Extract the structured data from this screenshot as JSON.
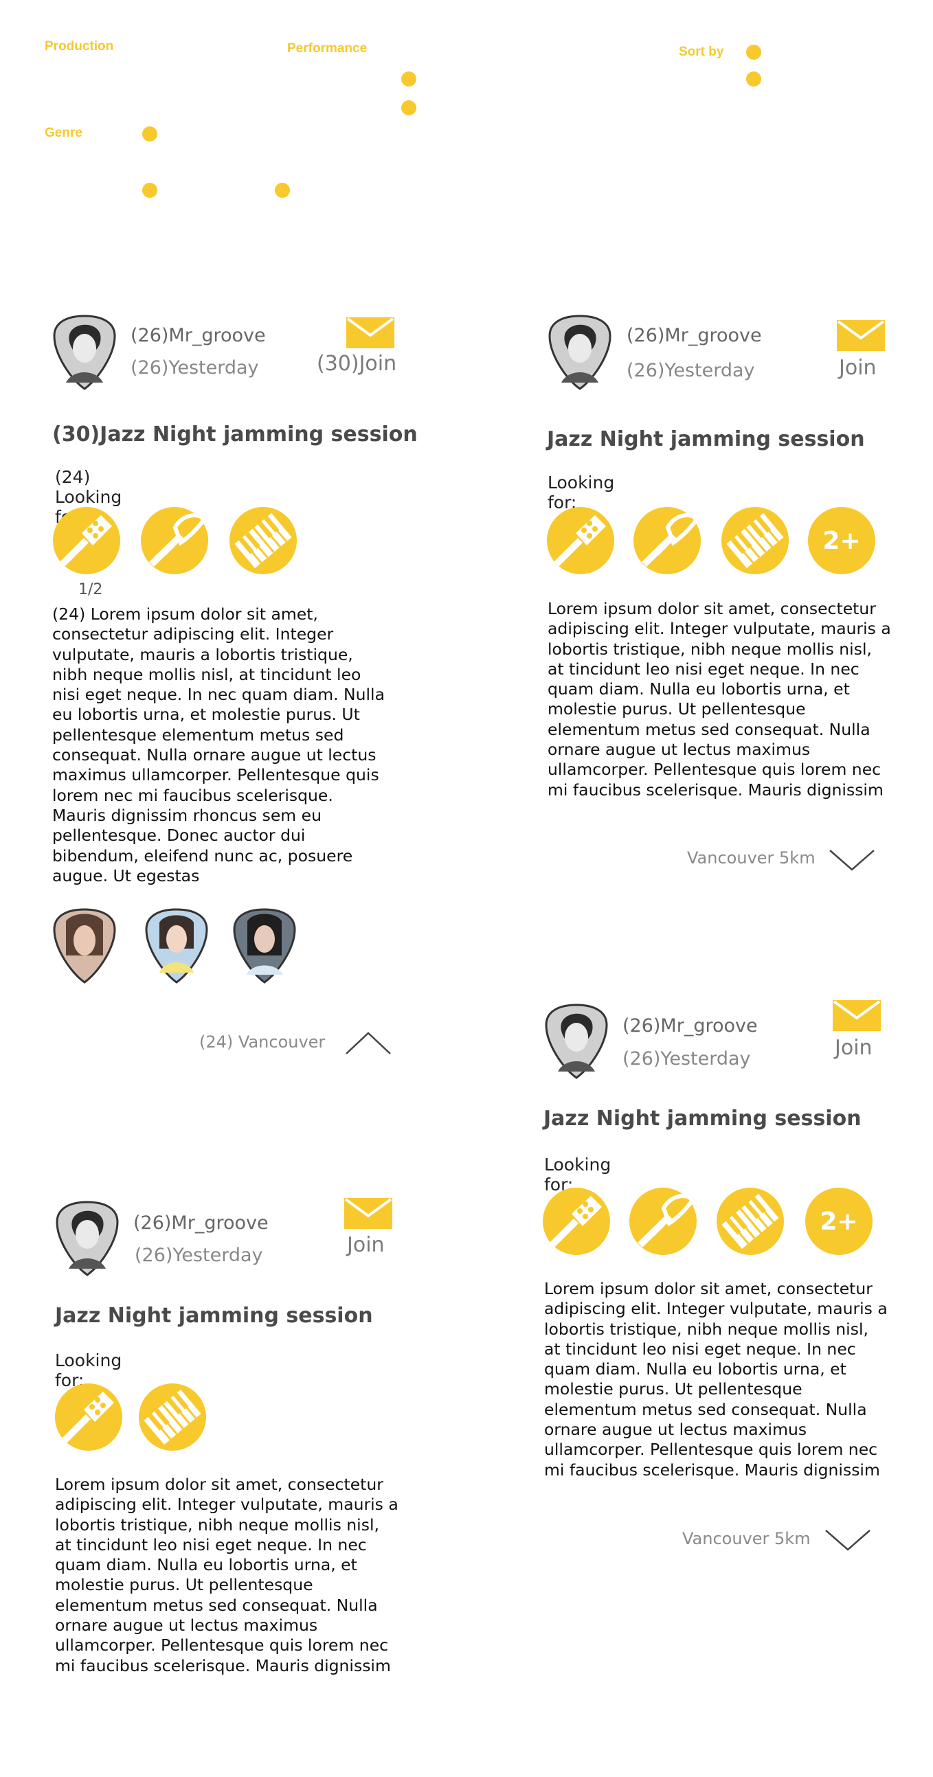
{
  "filters": {
    "production": "Production",
    "performance": "Performance",
    "sort_by": "Sort by",
    "genre": "Genre"
  },
  "cards": [
    {
      "username": "(26)Mr_groove",
      "time": "(26)Yesterday",
      "join": "(30)Join",
      "title": "(30)Jazz Night jamming session",
      "looking_for": "(24) Looking for:",
      "instruments": [
        "guitar-icon",
        "trumpet-icon",
        "piano-icon"
      ],
      "instrument_count": "1/2",
      "description": "(24) Lorem ipsum dolor sit amet, consectetur adipiscing elit. Integer vulputate, mauris a lobortis tristique, nibh neque mollis nisl, at tincidunt leo nisi eget neque. In nec quam diam. Nulla eu lobortis urna, et molestie purus. Ut pellentesque elementum metus sed consequat. Nulla ornare augue ut lectus maximus ullamcorper. Pellentesque quis lorem nec mi faucibus scelerisque. Mauris dignissim rhoncus sem eu pellentesque. Donec auctor dui bibendum, eleifend nunc ac, posuere augue. Ut egestas",
      "location": "(24) Vancouver",
      "expanded": true
    },
    {
      "username": "(26)Mr_groove",
      "time": "(26)Yesterday",
      "join": "Join",
      "title": "Jazz Night jamming session",
      "looking_for": "Looking for:",
      "instruments": [
        "guitar-icon",
        "trumpet-icon",
        "piano-icon"
      ],
      "more": "2+",
      "description": "Lorem ipsum dolor sit amet, consectetur adipiscing elit. Integer vulputate, mauris a lobortis tristique, nibh neque mollis nisl, at tincidunt leo nisi eget neque. In nec quam diam. Nulla eu lobortis urna, et molestie purus. Ut pellentesque elementum metus sed consequat. Nulla ornare augue ut lectus maximus ullamcorper. Pellentesque quis lorem nec mi faucibus scelerisque. Mauris dignissim",
      "location": "Vancouver 5km"
    },
    {
      "username": "(26)Mr_groove",
      "time": "(26)Yesterday",
      "join": "Join",
      "title": "Jazz Night jamming session",
      "looking_for": "Looking for:",
      "instruments": [
        "guitar-icon",
        "trumpet-icon",
        "piano-icon"
      ],
      "more": "2+",
      "description": "Lorem ipsum dolor sit amet, consectetur adipiscing elit. Integer vulputate, mauris a lobortis tristique, nibh neque mollis nisl, at tincidunt leo nisi eget neque. In nec quam diam. Nulla eu lobortis urna, et molestie purus. Ut pellentesque elementum metus sed consequat. Nulla ornare augue ut lectus maximus ullamcorper. Pellentesque quis lorem nec mi faucibus scelerisque. Mauris dignissim",
      "location": "Vancouver 5km"
    },
    {
      "username": "(26)Mr_groove",
      "time": "(26)Yesterday",
      "join": "Join",
      "title": "Jazz Night jamming session",
      "looking_for": "Looking for:",
      "instruments": [
        "guitar-icon",
        "piano-icon"
      ],
      "description": "Lorem ipsum dolor sit amet, consectetur adipiscing elit. Integer vulputate, mauris a lobortis tristique, nibh neque mollis nisl, at tincidunt leo nisi eget neque. In nec quam diam. Nulla eu lobortis urna, et molestie purus. Ut pellentesque elementum metus sed consequat. Nulla ornare augue ut lectus maximus ullamcorper. Pellentesque quis lorem nec mi faucibus scelerisque. Mauris dignissim"
    }
  ],
  "colors": {
    "accent": "#f7c92c",
    "text_gray": "#666666",
    "title_gray": "#4a4a4a"
  }
}
